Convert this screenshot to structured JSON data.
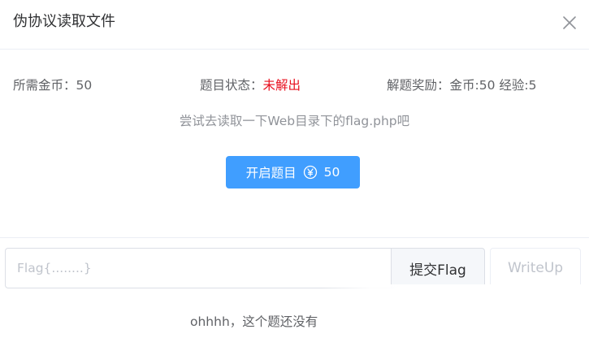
{
  "dialog": {
    "title": "伪协议读取文件",
    "close_icon": "close-icon"
  },
  "info": {
    "coin_label": "所需金币：",
    "coin_value": "50",
    "status_label": "题目状态：",
    "status_value": "未解出",
    "reward_label": "解题奖励：",
    "reward_value": "金币:50 经验:5"
  },
  "hint": "尝试去读取一下Web目录下的flag.php吧",
  "start_button": {
    "label": "开启题目",
    "icon": "yen-coin-icon",
    "cost": "50"
  },
  "flag_form": {
    "placeholder": "Flag{........}",
    "submit_label": "提交Flag",
    "writeup_label": "WriteUp"
  },
  "footer": {
    "text": "ohhhh，这个题还没有"
  },
  "colors": {
    "accent": "#409eff",
    "status_unsolved": "#e8101f",
    "muted": "#909399"
  }
}
